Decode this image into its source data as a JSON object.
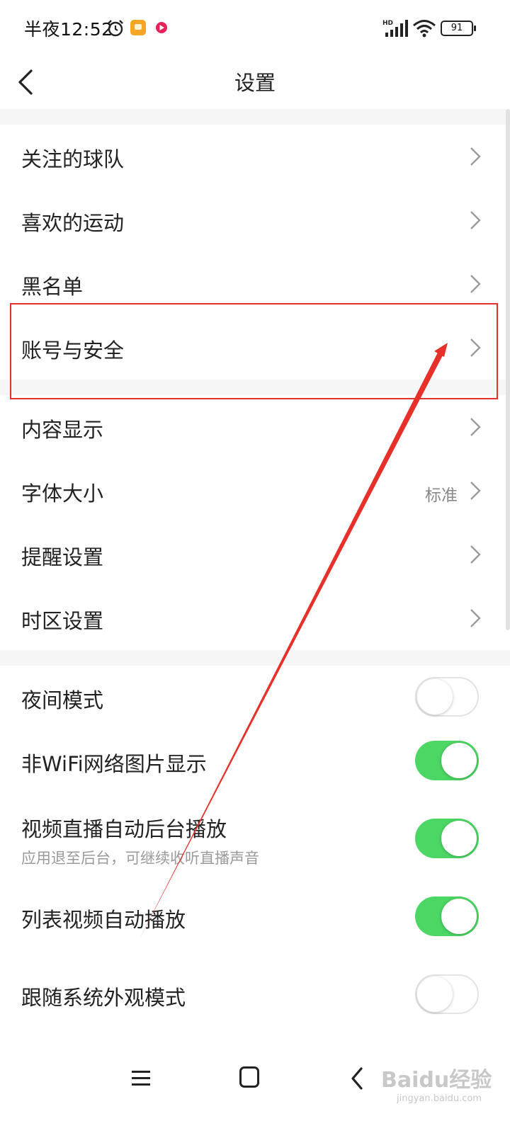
{
  "status_bar": {
    "time": "半夜12:52",
    "battery": "91",
    "network": "HD"
  },
  "header": {
    "title": "设置"
  },
  "group1": [
    {
      "label": "关注的球队"
    },
    {
      "label": "喜欢的运动"
    },
    {
      "label": "黑名单"
    },
    {
      "label": "账号与安全"
    }
  ],
  "group2": [
    {
      "label": "内容显示",
      "value": ""
    },
    {
      "label": "字体大小",
      "value": "标准"
    },
    {
      "label": "提醒设置",
      "value": ""
    },
    {
      "label": "时区设置",
      "value": ""
    }
  ],
  "toggles": [
    {
      "label": "夜间模式",
      "on": false
    },
    {
      "label": "非WiFi网络图片显示",
      "on": true
    },
    {
      "label": "视频直播自动后台播放",
      "sublabel": "应用退至后台，可继续收听直播声音",
      "on": true
    },
    {
      "label": "列表视频自动播放",
      "on": true
    },
    {
      "label": "跟随系统外观模式",
      "on": false
    }
  ],
  "watermark": {
    "text": "Baidu经验",
    "sub": "jingyan.baidu.com"
  },
  "colors": {
    "toggle_on": "#4cd664",
    "highlight": "#e8302a"
  }
}
